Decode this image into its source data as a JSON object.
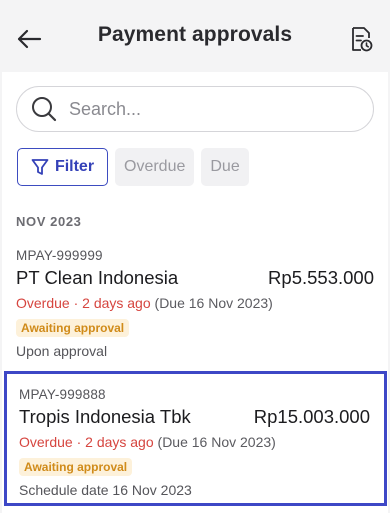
{
  "header": {
    "title": "Payment approvals",
    "back_icon": "arrow-left-icon",
    "action_icon": "document-clock-icon"
  },
  "search": {
    "placeholder": "Search..."
  },
  "filters": {
    "filter_label": "Filter",
    "chips": [
      "Overdue",
      "Due"
    ]
  },
  "section": {
    "title": "NOV 2023"
  },
  "payments": [
    {
      "ref": "MPAY-999999",
      "name": "PT Clean Indonesia",
      "amount": "Rp5.553.000",
      "overdue": "Overdue · 2 days ago",
      "due": "(Due 16 Nov 2023)",
      "badge": "Awaiting approval",
      "sub": "Upon approval"
    },
    {
      "ref": "MPAY-999888",
      "name": "Tropis Indonesia Tbk",
      "amount": "Rp15.003.000",
      "overdue": "Overdue · 2 days ago",
      "due": "(Due 16 Nov 2023)",
      "badge": "Awaiting approval",
      "sub": "Schedule date 16 Nov 2023"
    }
  ],
  "colors": {
    "accent": "#3d47c6",
    "overdue": "#d6453f",
    "badge_bg": "#fdf1da",
    "badge_text": "#d08b1a"
  }
}
